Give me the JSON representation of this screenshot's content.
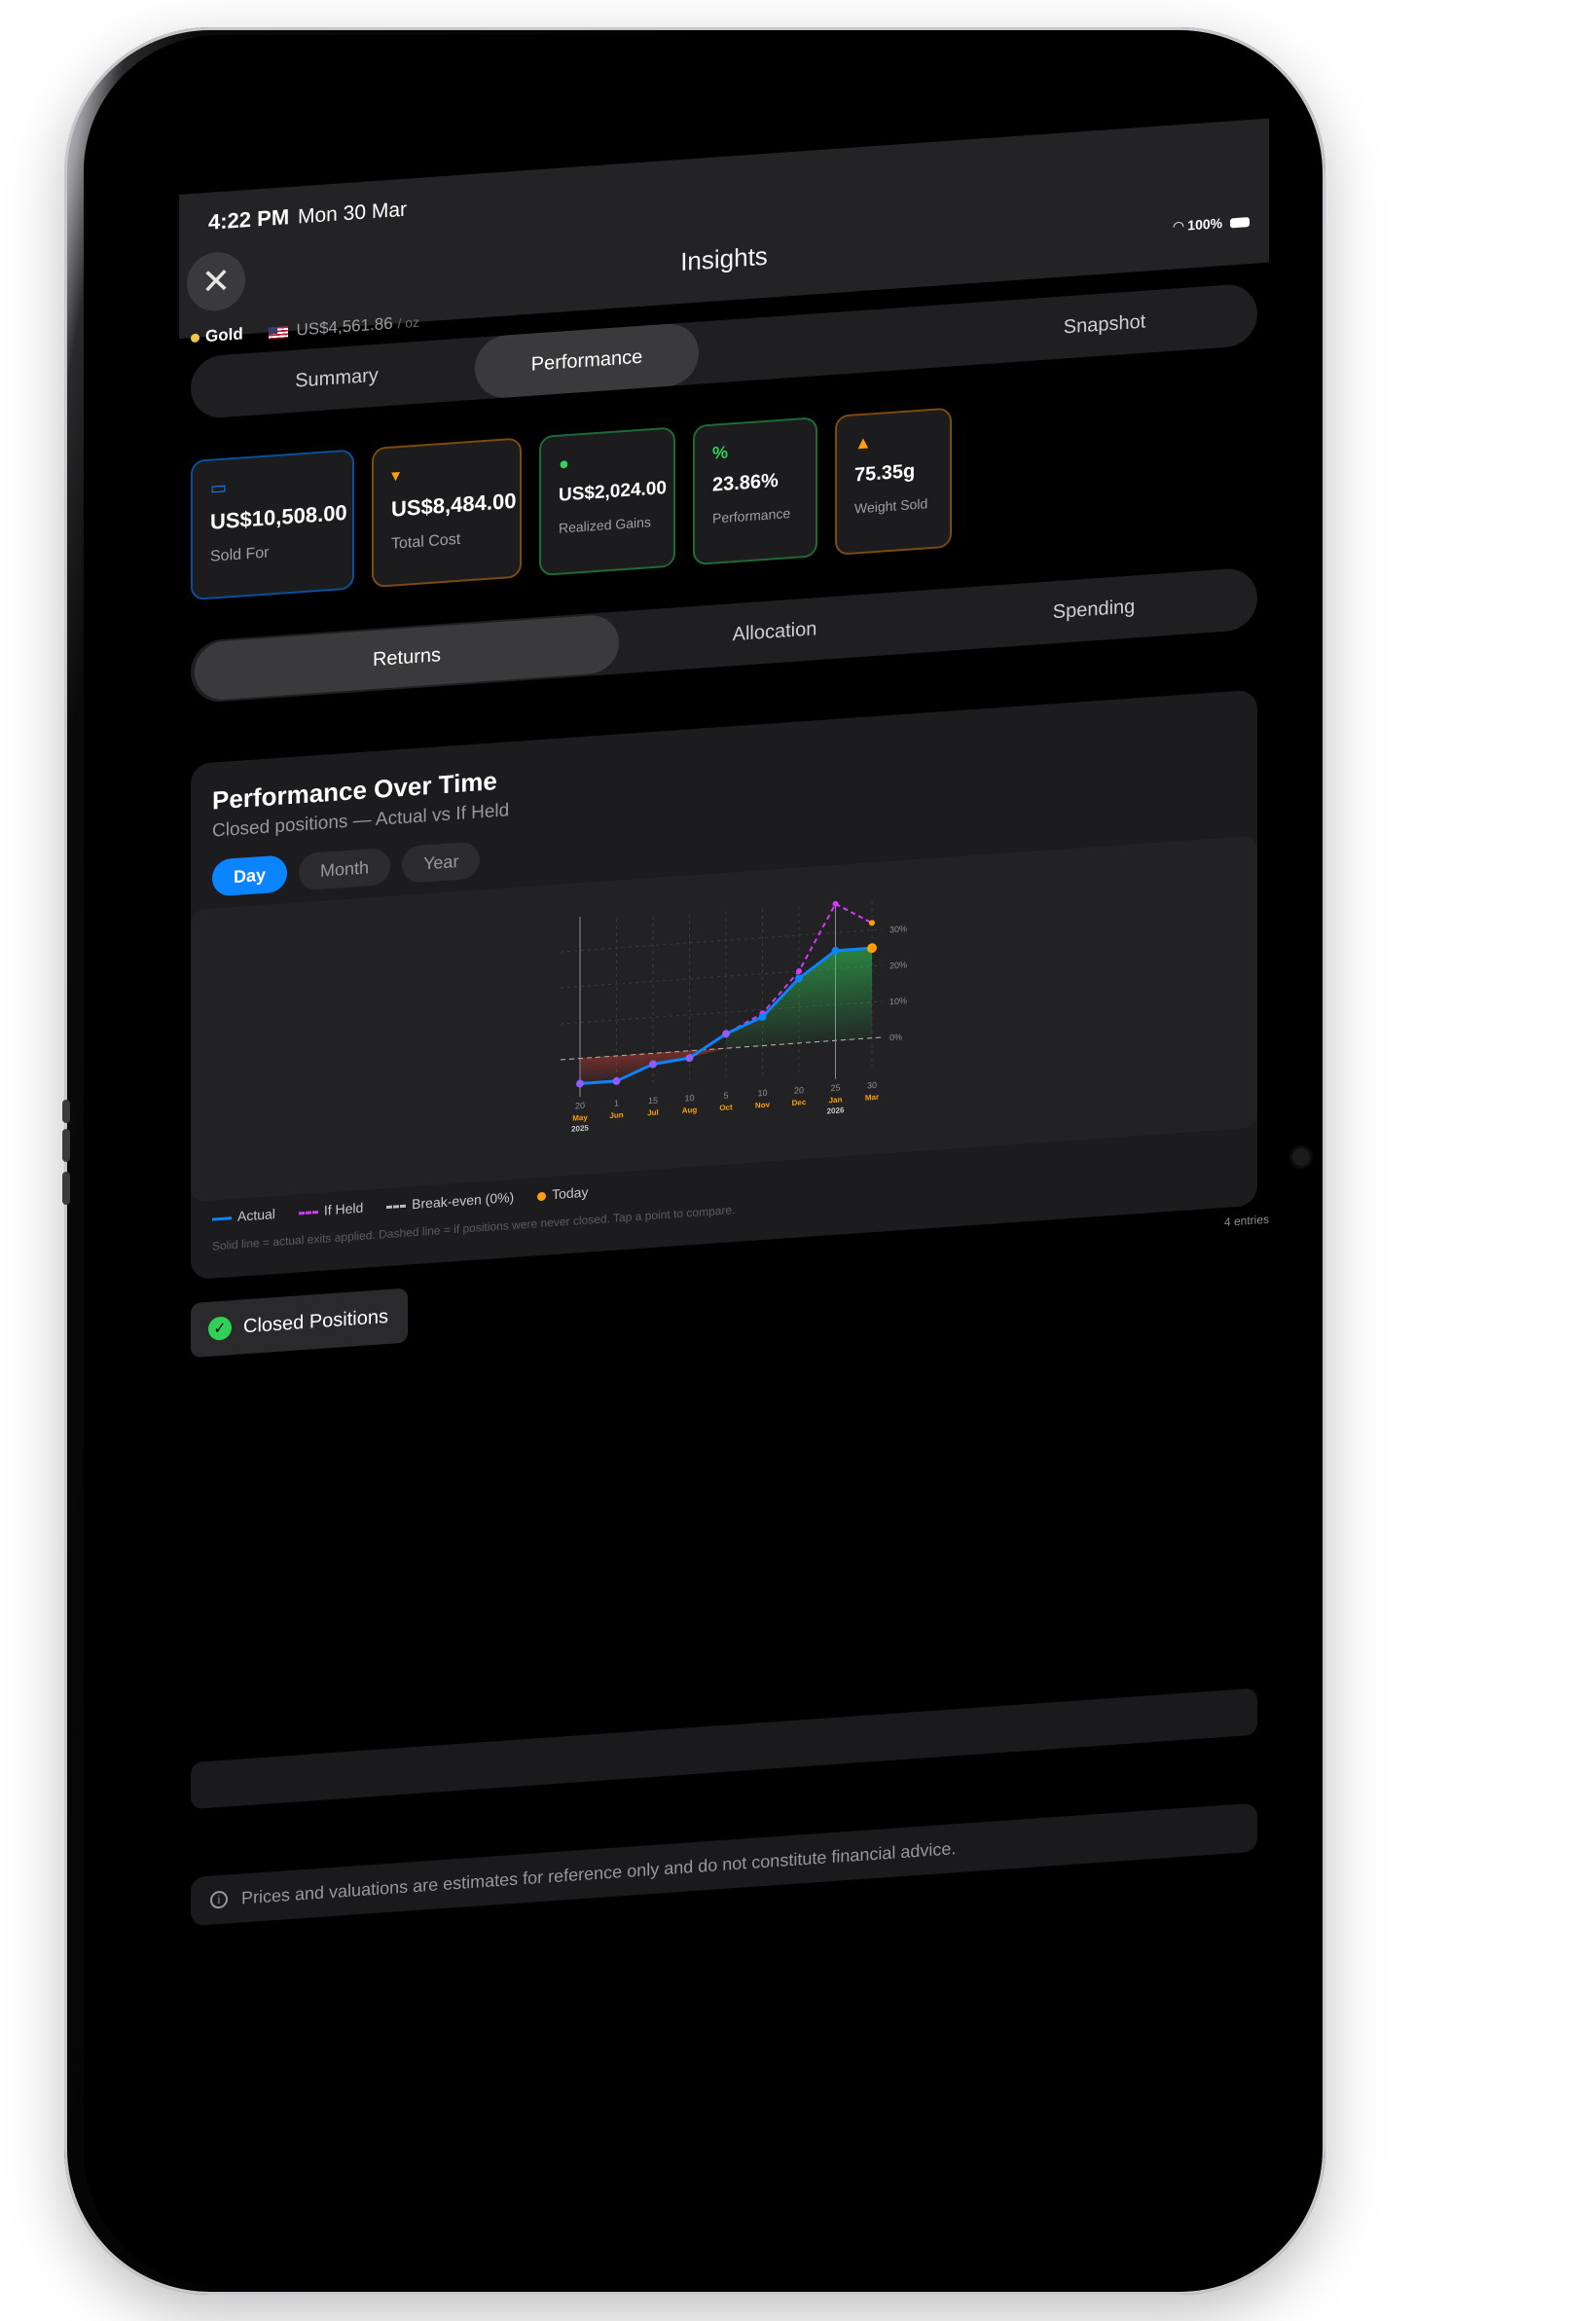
{
  "status": {
    "time": "4:22 PM",
    "date": "Mon 30 Mar",
    "battery": "100%"
  },
  "header": {
    "title": "Insights",
    "close_icon": "close-icon"
  },
  "asset": {
    "name": "Gold",
    "price": "US$4,561.86",
    "unit": "/ oz"
  },
  "tabs": [
    {
      "label": "Summary",
      "active": false
    },
    {
      "label": "Performance",
      "active": true
    },
    {
      "label": "Snapshot",
      "active": false
    }
  ],
  "cards": [
    {
      "icon": "cash-icon",
      "glyph": "▭",
      "value": "US$10,508.00",
      "label": "Sold For",
      "color": "#0a84ff"
    },
    {
      "icon": "cart-icon",
      "glyph": "🛒",
      "value": "US$8,484.00",
      "label": "Total Cost",
      "color": "#ff9f0a"
    },
    {
      "icon": "gain-arrow-icon",
      "glyph": "●",
      "value": "US$2,024.00",
      "label": "Realized Gains",
      "color": "#30d158"
    },
    {
      "icon": "percent-icon",
      "glyph": "%",
      "value": "23.86%",
      "label": "Performance",
      "color": "#30d158"
    },
    {
      "icon": "weight-icon",
      "glyph": "▲",
      "value": "75.35g",
      "label": "Weight Sold",
      "color": "#ff9f0a"
    }
  ],
  "subtabs": [
    {
      "label": "Returns",
      "active": true
    },
    {
      "label": "Allocation",
      "active": false
    },
    {
      "label": "Spending",
      "active": false
    }
  ],
  "chart": {
    "title": "Performance Over Time",
    "subtitle": "Closed positions — Actual vs If Held",
    "ranges": [
      {
        "label": "Day",
        "active": true
      },
      {
        "label": "Month",
        "active": false
      },
      {
        "label": "Year",
        "active": false
      }
    ],
    "legend": {
      "actual": "Actual",
      "if_held": "If Held",
      "breakeven": "Break-even (0%)",
      "today": "Today"
    },
    "note": "Solid line = actual exits applied. Dashed line = if positions were never closed. Tap a point to compare.",
    "colors": {
      "actual": "#0a84ff",
      "if_held": "#d63aff",
      "breakeven": "#8e8e93",
      "today": "#ff9f0a",
      "gain_fill": "#30d158",
      "loss_fill": "#ff453a"
    }
  },
  "chart_data": {
    "type": "line",
    "x_ticks": [
      {
        "day": "20",
        "month": "May",
        "year": "2025"
      },
      {
        "day": "1",
        "month": "Jun",
        "year": ""
      },
      {
        "day": "15",
        "month": "Jul",
        "year": ""
      },
      {
        "day": "10",
        "month": "Aug",
        "year": ""
      },
      {
        "day": "5",
        "month": "Oct",
        "year": ""
      },
      {
        "day": "10",
        "month": "Nov",
        "year": ""
      },
      {
        "day": "20",
        "month": "Dec",
        "year": ""
      },
      {
        "day": "25",
        "month": "Jan",
        "year": "2026"
      },
      {
        "day": "30",
        "month": "Mar",
        "year": ""
      }
    ],
    "y_ticks": [
      "30%",
      "20%",
      "10%",
      "0%"
    ],
    "ylim": [
      -8,
      38
    ],
    "series": [
      {
        "name": "Actual",
        "values": [
          -7,
          -7,
          -3,
          -2,
          4,
          8,
          18,
          25,
          25
        ]
      },
      {
        "name": "If Held",
        "values": [
          -7,
          -7,
          -3,
          -2,
          4,
          9,
          20,
          38,
          32
        ]
      }
    ]
  },
  "closed": {
    "entries": "4 entries",
    "label": "Closed Positions"
  },
  "footer": {
    "disclaimer": "Prices and valuations are estimates for reference only and do not constitute financial advice."
  }
}
